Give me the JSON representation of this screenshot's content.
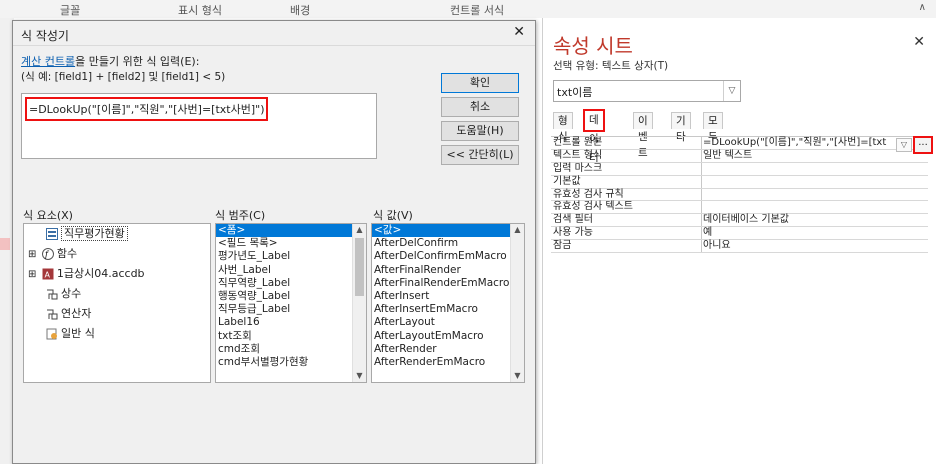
{
  "ribbon": {
    "items": [
      "글꼴",
      "표시 형식",
      "배경",
      "컨트롤 서식"
    ]
  },
  "dialog": {
    "title": "식 작성기",
    "instruction_link": "계산 컨트롤",
    "instruction_rest": "을 만들기 위한 식 입력(E):",
    "example": "(식 예: [field1] + [field2] 및 [field1] < 5)",
    "expression": "=DLookUp(\"[이름]\",\"직원\",\"[사번]=[txt사번]\")",
    "buttons": {
      "ok": "확인",
      "cancel": "취소",
      "help": "도움말(H)",
      "less": "<< 간단히(L)"
    },
    "elements_label": "식 요소(X)",
    "categories_label": "식 범주(C)",
    "values_label": "식 값(V)",
    "elements": [
      {
        "label": "직무평가현황",
        "icon": "form-icon",
        "expand": ""
      },
      {
        "label": "함수",
        "icon": "function-icon",
        "expand": "⊞"
      },
      {
        "label": "1급상시04.accdb",
        "icon": "database-icon",
        "expand": "⊞"
      },
      {
        "label": "상수",
        "icon": "constant-icon",
        "expand": ""
      },
      {
        "label": "연산자",
        "icon": "operator-icon",
        "expand": ""
      },
      {
        "label": "일반 식",
        "icon": "expression-icon",
        "expand": ""
      }
    ],
    "categories": [
      "<폼>",
      "<필드 목록>",
      "평가년도_Label",
      "사번_Label",
      "직무역량_Label",
      "행동역량_Label",
      "직무등급_Label",
      "Label16",
      "txt조회",
      "cmd조회",
      "cmd부서별평가현황"
    ],
    "values": [
      "<값>",
      "AfterDelConfirm",
      "AfterDelConfirmEmMacro",
      "AfterFinalRender",
      "AfterFinalRenderEmMacro",
      "AfterInsert",
      "AfterInsertEmMacro",
      "AfterLayout",
      "AfterLayoutEmMacro",
      "AfterRender",
      "AfterRenderEmMacro"
    ]
  },
  "sheet": {
    "title": "속성 시트",
    "selection_type": "선택 유형: 텍스트 상자(T)",
    "selected_control": "txt이름",
    "tabs": [
      "형식",
      "데이터",
      "이벤트",
      "기타",
      "모두"
    ],
    "active_tab": "데이터",
    "properties": [
      {
        "name": "컨트롤 원본",
        "value": "=DLookUp(\"[이름]\",\"직원\",\"[사번]=[txt"
      },
      {
        "name": "텍스트 형식",
        "value": "일반 텍스트"
      },
      {
        "name": "입력 마스크",
        "value": ""
      },
      {
        "name": "기본값",
        "value": ""
      },
      {
        "name": "유효성 검사 규칙",
        "value": ""
      },
      {
        "name": "유효성 검사 텍스트",
        "value": ""
      },
      {
        "name": "검색 필터",
        "value": "데이터베이스 기본값"
      },
      {
        "name": "사용 가능",
        "value": "예"
      },
      {
        "name": "잠금",
        "value": "아니요"
      }
    ],
    "builder_button": "..."
  },
  "colors": {
    "highlight": "#e11111",
    "selection": "#0078d7",
    "link": "#0b5fb0",
    "sheet_title": "#c0392b"
  }
}
